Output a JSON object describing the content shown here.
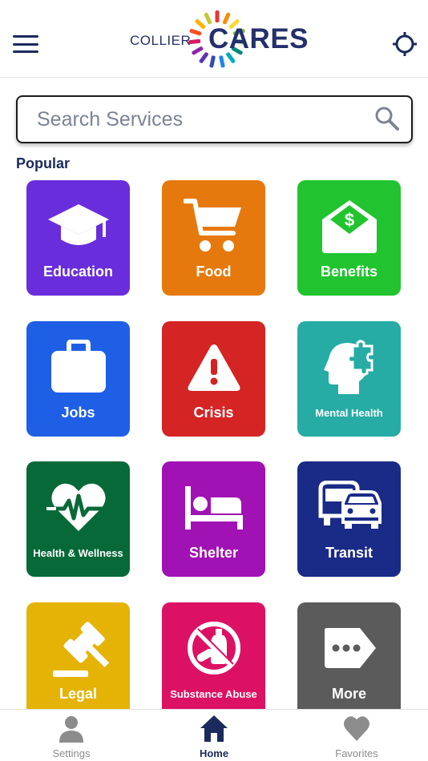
{
  "header": {
    "logo_small": "COLLIER",
    "logo_big": "CARES",
    "menu_icon": "hamburger-menu-icon",
    "locate_icon": "crosshair-location-icon"
  },
  "search": {
    "placeholder": "Search Services",
    "value": "",
    "icon": "search-icon"
  },
  "section_title": "Popular",
  "tiles": [
    {
      "label": "Education",
      "icon": "graduation-cap-icon",
      "color": "#6a2ddb"
    },
    {
      "label": "Food",
      "icon": "shopping-cart-icon",
      "color": "#e6790d"
    },
    {
      "label": "Benefits",
      "icon": "money-envelope-icon",
      "color": "#21c42f"
    },
    {
      "label": "Jobs",
      "icon": "briefcase-icon",
      "color": "#1f5fe6"
    },
    {
      "label": "Crisis",
      "icon": "warning-triangle-icon",
      "color": "#d42424"
    },
    {
      "label": "Mental Health",
      "icon": "head-puzzle-icon",
      "color": "#26aca4"
    },
    {
      "label": "Health & Wellness",
      "icon": "heart-pulse-icon",
      "color": "#076938"
    },
    {
      "label": "Shelter",
      "icon": "bed-icon",
      "color": "#a012b4"
    },
    {
      "label": "Transit",
      "icon": "bus-car-icon",
      "color": "#1a2a87"
    },
    {
      "label": "Legal",
      "icon": "gavel-icon",
      "color": "#e4b305"
    },
    {
      "label": "Substance Abuse",
      "icon": "no-drugs-icon",
      "color": "#dc1164"
    },
    {
      "label": "More",
      "icon": "more-tag-icon",
      "color": "#5b5b5b"
    }
  ],
  "tabs": [
    {
      "label": "Settings",
      "icon": "person-icon",
      "active": false
    },
    {
      "label": "Home",
      "icon": "home-icon",
      "active": true
    },
    {
      "label": "Favorites",
      "icon": "heart-icon",
      "active": false
    }
  ],
  "colors": {
    "brand_navy": "#1b2a5c",
    "tab_inactive": "#8c8c8c"
  }
}
